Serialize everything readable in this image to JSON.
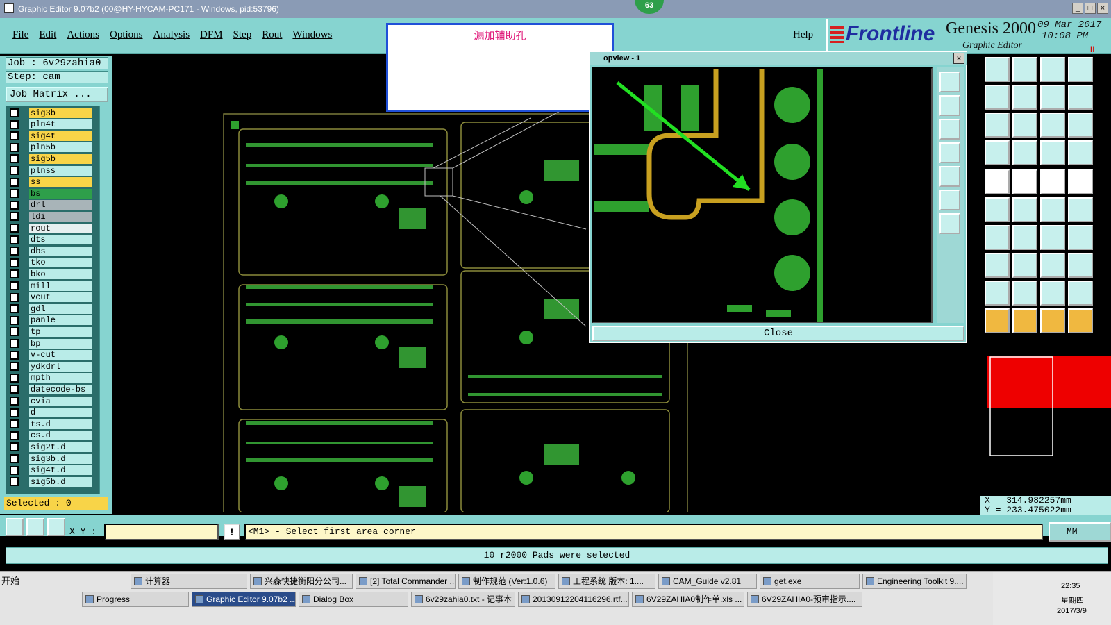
{
  "window": {
    "title": "Graphic Editor 9.07b2 (00@HY-HYCAM-PC171 - Windows, pid:53796)",
    "badge": "63"
  },
  "window_controls": [
    "_",
    "□",
    "×"
  ],
  "menu": [
    "File",
    "Edit",
    "Actions",
    "Options",
    "Analysis",
    "DFM",
    "Step",
    "Rout",
    "Windows"
  ],
  "help": "Help",
  "brand": {
    "frontline": "Frontline",
    "genesis": "Genesis 2000",
    "editor": "Graphic Editor",
    "date": "09 Mar 2017",
    "time": "10:08 PM",
    "pause": "II"
  },
  "job": {
    "job_label": "Job : 6v29zahia0",
    "step_label": "Step: cam",
    "matrix_button": "Job Matrix ..."
  },
  "layers": [
    {
      "name": "sig3b",
      "color": "#f8d448"
    },
    {
      "name": "pln4t",
      "color": "#b9ece8"
    },
    {
      "name": "sig4t",
      "color": "#f8d448"
    },
    {
      "name": "pln5b",
      "color": "#b9ece8"
    },
    {
      "name": "sig5b",
      "color": "#f8d448"
    },
    {
      "name": "plnss",
      "color": "#b9ece8"
    },
    {
      "name": "ss",
      "color": "#f8d448"
    },
    {
      "name": "bs",
      "color": "#2e9f4a"
    },
    {
      "name": "drl",
      "color": "#a8b4b8"
    },
    {
      "name": "ldi",
      "color": "#a8b4b8"
    },
    {
      "name": "rout",
      "color": "#e6f0f0"
    },
    {
      "name": "dts",
      "color": "#b9ece8"
    },
    {
      "name": "dbs",
      "color": "#b9ece8"
    },
    {
      "name": "tko",
      "color": "#b9ece8"
    },
    {
      "name": "bko",
      "color": "#b9ece8"
    },
    {
      "name": "mill",
      "color": "#b9ece8"
    },
    {
      "name": "vcut",
      "color": "#b9ece8"
    },
    {
      "name": "gdl",
      "color": "#b9ece8"
    },
    {
      "name": "panle",
      "color": "#b9ece8"
    },
    {
      "name": "tp",
      "color": "#b9ece8"
    },
    {
      "name": "bp",
      "color": "#b9ece8"
    },
    {
      "name": "v-cut",
      "color": "#b9ece8"
    },
    {
      "name": "ydkdrl",
      "color": "#b9ece8"
    },
    {
      "name": "mpth",
      "color": "#b9ece8"
    },
    {
      "name": "datecode-bs",
      "color": "#b9ece8"
    },
    {
      "name": "cvia",
      "color": "#b9ece8"
    },
    {
      "name": "d",
      "color": "#b9ece8"
    },
    {
      "name": "ts.d",
      "color": "#b9ece8"
    },
    {
      "name": "cs.d",
      "color": "#b9ece8"
    },
    {
      "name": "sig2t.d",
      "color": "#b9ece8"
    },
    {
      "name": "sig3b.d",
      "color": "#b9ece8"
    },
    {
      "name": "sig4t.d",
      "color": "#b9ece8"
    },
    {
      "name": "sig5b.d",
      "color": "#b9ece8"
    }
  ],
  "selected": "Selected : 0",
  "memo": {
    "text": "漏加辅助孔"
  },
  "popview": {
    "title": "opview - 1",
    "close_label": "Close",
    "close_x": "×"
  },
  "coords": {
    "x": "X = 314.982257mm",
    "y": "Y = 233.475022mm"
  },
  "bottom": {
    "xy_label": "X Y :",
    "xy_value": "",
    "info": "!",
    "prompt": "<M1> - Select first area corner",
    "units": "MM"
  },
  "status": "10 r2000 Pads were selected",
  "taskbar": {
    "start": "开始",
    "row1": [
      "计算器",
      "兴森快捷衡阳分公司...",
      "[2] Total Commander ...",
      "制作规范 (Ver:1.0.6)",
      "工程系统  版本: 1....",
      "CAM_Guide v2.81",
      "get.exe",
      "Engineering Toolkit 9...."
    ],
    "row2": [
      "Progress",
      "Graphic Editor 9.07b2 ...",
      "Dialog Box",
      "6v29zahia0.txt - 记事本",
      "20130912204116296.rtf...",
      "6V29ZAHIA0制作单.xls ...",
      "6V29ZAHIA0-预审指示...."
    ],
    "clock_time": "22:35",
    "clock_day": "星期四",
    "clock_date": "2017/3/9"
  }
}
